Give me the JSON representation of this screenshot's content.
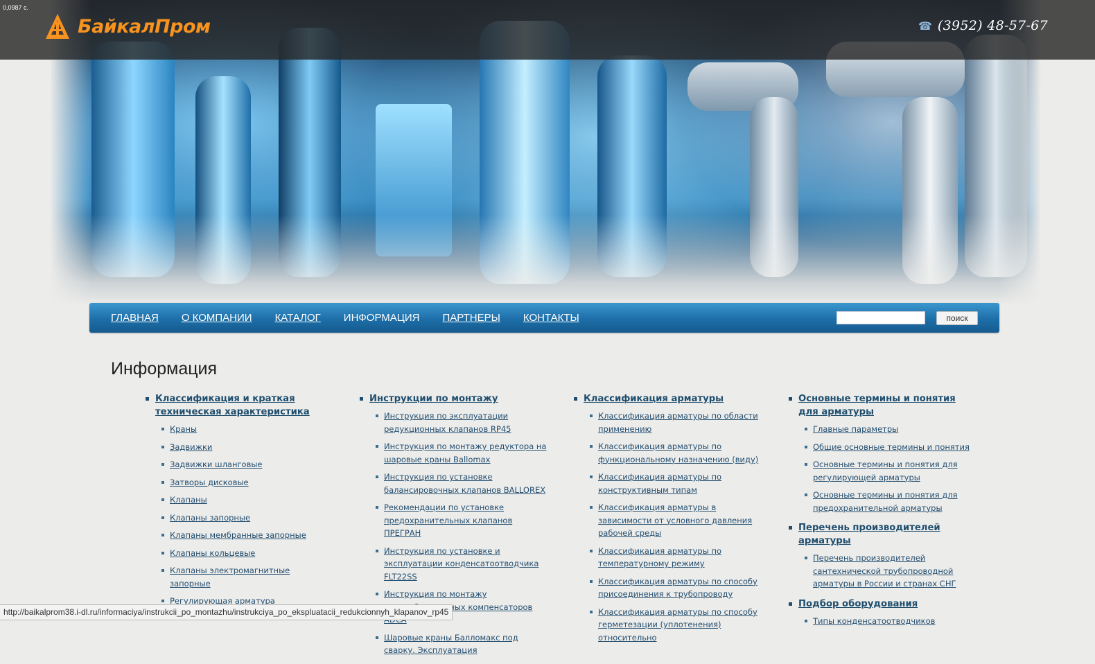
{
  "timing": "0,0987 с.",
  "header": {
    "logo_text": "БайкалПром",
    "phone": "(3952) 48-57-67",
    "phone_icon": "phone-icon"
  },
  "nav": {
    "items": [
      {
        "label": "ГЛАВНАЯ",
        "active": false
      },
      {
        "label": "О КОМПАНИИ",
        "active": false
      },
      {
        "label": "КАТАЛОГ",
        "active": false
      },
      {
        "label": "ИНФОРМАЦИЯ",
        "active": true
      },
      {
        "label": "ПАРТНЕРЫ",
        "active": false
      },
      {
        "label": "КОНТАКТЫ",
        "active": false
      }
    ],
    "search_value": "",
    "search_button": "поиск"
  },
  "page_title": "Информация",
  "columns": [
    {
      "sections": [
        {
          "title": "Классификация и краткая техническая характеристика",
          "items": [
            "Краны",
            "Задвижки",
            "Задвижки шланговые",
            "Затворы дисковые",
            "Клапаны",
            "Клапаны запорные",
            "Клапаны мембранные запорные",
            "Клапаны кольцевые",
            "Клапаны электромагнитные запорные",
            "Регулирующая арматура"
          ]
        }
      ]
    },
    {
      "sections": [
        {
          "title": "Инструкции по монтажу",
          "items": [
            "Инструкция по эксплуатации редукционных клапанов RP45",
            "Инструкция по монтажу редуктора на шаровые краны Ballomax",
            "Инструкция по установке балансировочных клапанов BALLOREX",
            "Рекомендации по установке предохранительных клапанов ПРЕГРАН",
            "Инструкция по установке и эксплуатации конденсатоотводчика FLT22SS",
            "Инструкция по монтажу антивибрационных компенсаторов ADCA",
            "Шаровые краны Балломакс под сварку. Эксплуатация"
          ]
        }
      ]
    },
    {
      "sections": [
        {
          "title": "Классификация арматуры",
          "items": [
            "Классификация арматуры по области применению",
            "Классификация арматуры по функциональному назначению (виду)",
            "Классификация арматуры по конструктивным типам",
            "Классификация арматуры в зависимости от условного давления рабочей среды",
            "Классификация арматуры по температурному режиму",
            "Классификация арматуры по способу присоединения к трубопроводу",
            "Классификация арматуры по способу герметезации (уплотенения) относительно"
          ]
        }
      ]
    },
    {
      "sections": [
        {
          "title": "Основные термины и понятия для арматуры",
          "items": [
            "Главные параметры",
            "Общие основные термины и понятия",
            "Основные термины и понятия для регулирующей арматуры",
            "Основные термины и понятия для предохранительной арматуры"
          ]
        },
        {
          "title": "Перечень производителей арматуры",
          "items": [
            "Перечень производителей сантехнической трубопроводной арматуры в России и странах СНГ"
          ]
        },
        {
          "title": "Подбор оборудования",
          "items": [
            "Типы конденсатоотводчиков"
          ]
        }
      ]
    }
  ],
  "status_bar": "http://baikalprom38.i-dl.ru/informaciya/instrukcii_po_montazhu/instrukciya_po_ekspluatacii_redukcionnyh_klapanov_rp45",
  "colors": {
    "nav_blue": "#1d6ea8",
    "logo_orange": "#f7931e",
    "link_blue": "#1f4e6e"
  }
}
